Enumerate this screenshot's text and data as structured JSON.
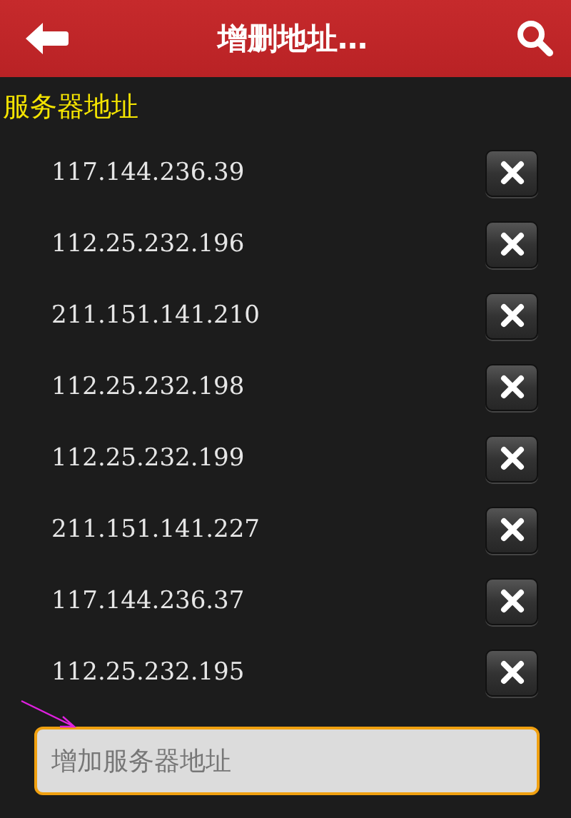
{
  "header": {
    "title": "增删地址…"
  },
  "section": {
    "label": "服务器地址"
  },
  "servers": [
    {
      "address": "117.144.236.39"
    },
    {
      "address": "112.25.232.196"
    },
    {
      "address": "211.151.141.210"
    },
    {
      "address": "112.25.232.198"
    },
    {
      "address": "112.25.232.199"
    },
    {
      "address": "211.151.141.227"
    },
    {
      "address": "117.144.236.37"
    },
    {
      "address": "112.25.232.195"
    }
  ],
  "add_field": {
    "placeholder": "增加服务器地址"
  }
}
